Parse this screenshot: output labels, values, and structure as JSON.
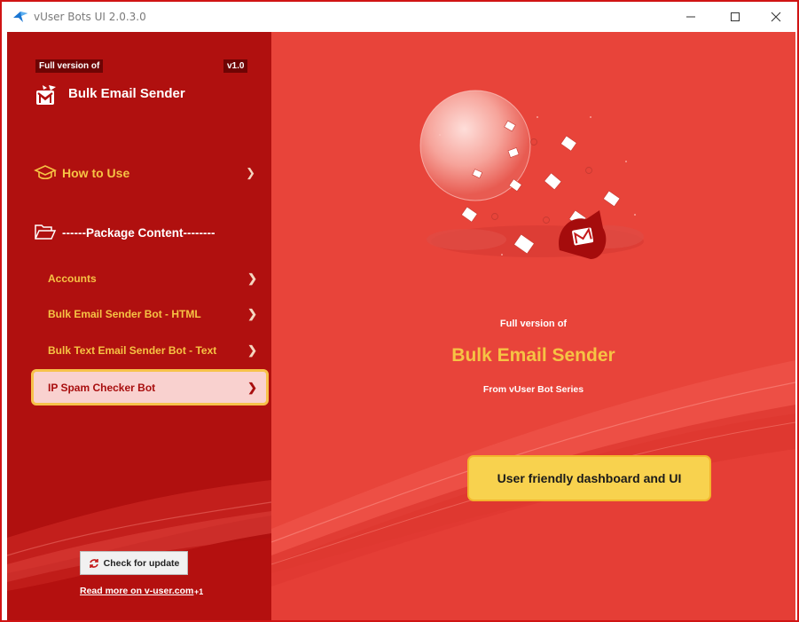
{
  "window": {
    "title": "vUser Bots UI 2.0.3.0",
    "minimize_icon": "minimize-icon",
    "maximize_icon": "maximize-icon",
    "close_icon": "close-icon"
  },
  "sidebar": {
    "badge": "Full version of",
    "version": "v1.0",
    "product_name": "Bulk Email Sender",
    "how_to_use": "How to Use",
    "package_content": "------Package Content--------",
    "items": [
      {
        "label": "Accounts"
      },
      {
        "label": "Bulk Email Sender Bot - HTML"
      },
      {
        "label": "Bulk Text Email Sender Bot - Text"
      },
      {
        "label": "IP Spam Checker Bot"
      }
    ],
    "check_update": "Check for update",
    "read_more": "Read more on v-user.com",
    "read_more_badge": "+1"
  },
  "content": {
    "full_version": "Full version of",
    "title": "Bulk Email Sender",
    "subtitle": "From vUser Bot Series",
    "feature": "User friendly dashboard and UI"
  },
  "colors": {
    "sidebar_bg": "#b0100f",
    "content_bg": "#e8443a",
    "accent_yellow": "#f6c344",
    "active_item_bg": "#f9d1cf"
  }
}
